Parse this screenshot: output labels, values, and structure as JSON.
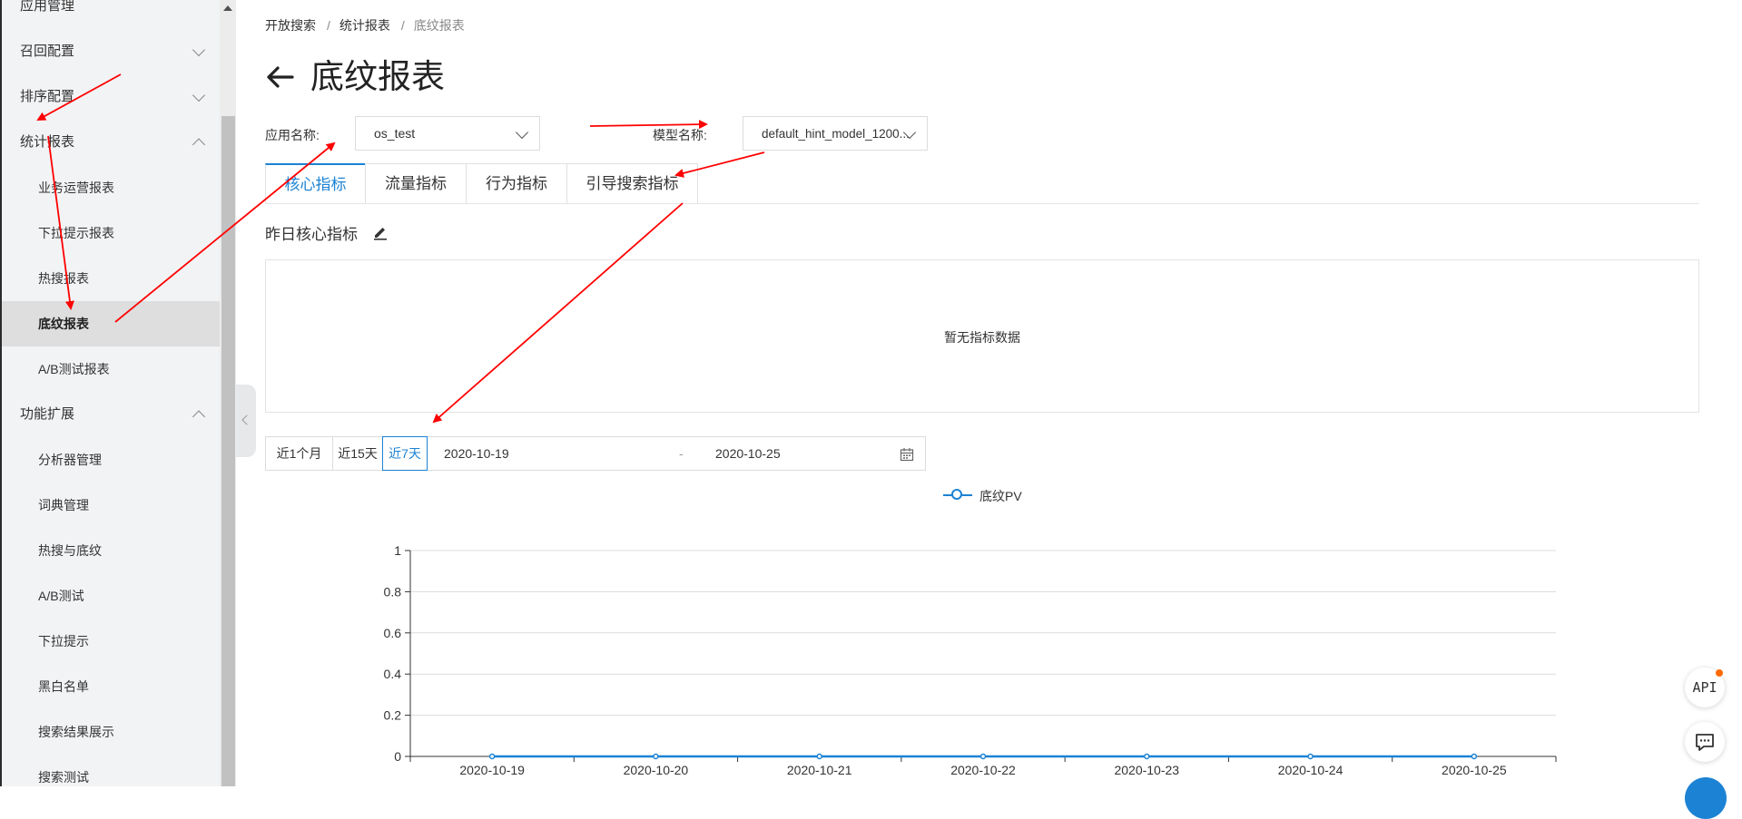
{
  "sidebar": {
    "items": [
      {
        "label": "应用管理",
        "type": "group",
        "expanded": null
      },
      {
        "label": "召回配置",
        "type": "group",
        "expanded": false
      },
      {
        "label": "排序配置",
        "type": "group",
        "expanded": false
      },
      {
        "label": "统计报表",
        "type": "group",
        "expanded": true
      },
      {
        "label": "业务运营报表",
        "type": "sub"
      },
      {
        "label": "下拉提示报表",
        "type": "sub"
      },
      {
        "label": "热搜报表",
        "type": "sub"
      },
      {
        "label": "底纹报表",
        "type": "sub",
        "active": true
      },
      {
        "label": "A/B测试报表",
        "type": "sub"
      },
      {
        "label": "功能扩展",
        "type": "group",
        "expanded": true
      },
      {
        "label": "分析器管理",
        "type": "sub"
      },
      {
        "label": "词典管理",
        "type": "sub"
      },
      {
        "label": "热搜与底纹",
        "type": "sub"
      },
      {
        "label": "A/B测试",
        "type": "sub"
      },
      {
        "label": "下拉提示",
        "type": "sub"
      },
      {
        "label": "黑白名单",
        "type": "sub"
      },
      {
        "label": "搜索结果展示",
        "type": "sub"
      },
      {
        "label": "搜索测试",
        "type": "sub"
      }
    ]
  },
  "breadcrumb": [
    "开放搜索",
    "统计报表",
    "底纹报表"
  ],
  "page_title": "底纹报表",
  "filters": {
    "app_label": "应用名称:",
    "app_value": "os_test",
    "model_label": "模型名称:",
    "model_value": "default_hint_model_1200..."
  },
  "tabs": [
    "核心指标",
    "流量指标",
    "行为指标",
    "引导搜索指标"
  ],
  "active_tab": 0,
  "section_title": "昨日核心指标",
  "empty_text": "暂无指标数据",
  "range_buttons": [
    "近1个月",
    "近15天",
    "近7天"
  ],
  "active_range": 2,
  "date_start": "2020-10-19",
  "date_separator": "-",
  "date_end": "2020-10-25",
  "float_buttons": {
    "api_label": "API",
    "chat_icon": "chat-icon"
  },
  "colors": {
    "accent": "#1c82d4",
    "annotation": "#ff0000",
    "badge": "#ff6a00"
  },
  "chart_data": {
    "type": "line",
    "legend": "top-center",
    "x": [
      "2020-10-19",
      "2020-10-20",
      "2020-10-21",
      "2020-10-22",
      "2020-10-23",
      "2020-10-24",
      "2020-10-25"
    ],
    "series": [
      {
        "name": "底纹PV",
        "values": [
          0,
          0,
          0,
          0,
          0,
          0,
          0
        ]
      }
    ],
    "yticks": [
      "0",
      "0.2",
      "0.4",
      "0.6",
      "0.8",
      "1"
    ],
    "ylim": [
      0,
      1
    ],
    "grid": true
  }
}
